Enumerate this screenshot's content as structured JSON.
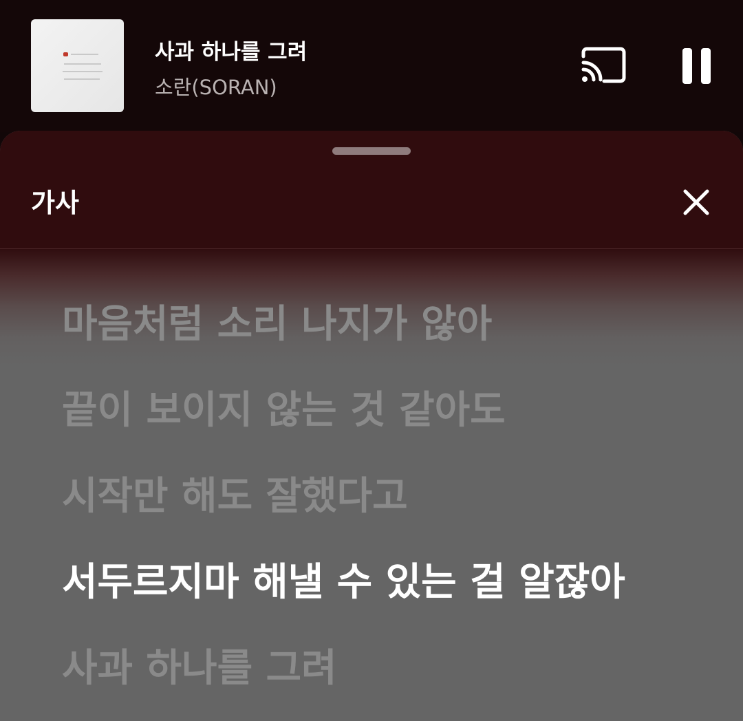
{
  "now_playing": {
    "title": "사과 하나를 그려",
    "artist": "소란(SORAN)"
  },
  "controls": {
    "cast_icon": "cast-icon",
    "pause_icon": "pause-icon"
  },
  "lyrics_panel": {
    "title": "가사",
    "close_icon": "close-icon",
    "lines": [
      "마음처럼 소리 나지가 않아",
      "끝이 보이지 않는 것 같아도",
      "시작만 해도 잘했다고",
      "서두르지마 해낼 수 있는 걸 알잖아",
      "사과 하나를 그려"
    ],
    "active_line_index": 3
  },
  "colors": {
    "header_bg": "#140708",
    "sheet_header_bg": "#300c0e",
    "lyrics_bg": "#656565",
    "active_lyric": "#ffffff",
    "inactive_lyric": "#8a8a8a"
  }
}
